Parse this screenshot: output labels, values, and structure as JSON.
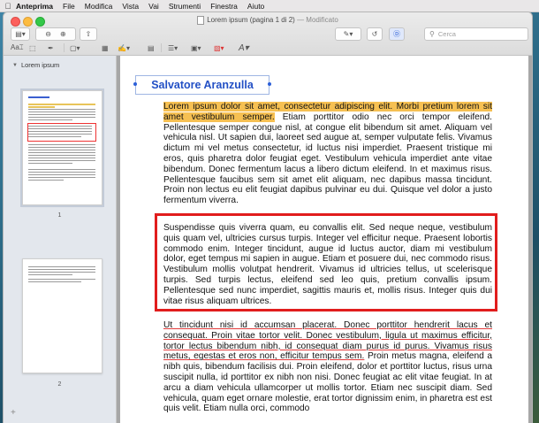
{
  "menubar": {
    "app_name": "Anteprima",
    "items": [
      "File",
      "Modifica",
      "Vista",
      "Vai",
      "Strumenti",
      "Finestra",
      "Aiuto"
    ]
  },
  "window": {
    "title": "Lorem ipsum (pagina 1 di 2)",
    "title_suffix": "— Modificato",
    "search_placeholder": "Cerca"
  },
  "sidebar": {
    "header": "Lorem ipsum",
    "pages": [
      "1",
      "2"
    ]
  },
  "document": {
    "annotation_text": "Salvatore Aranzulla",
    "paragraph1_highlight": "Lorem ipsum dolor sit amet, consectetur adipiscing elit. Morbi pretium lorem sit amet vestibulum semper.",
    "paragraph1_rest": " Etiam porttitor odio nec orci tempor eleifend. Pellentesque semper congue nisl, at congue elit bibendum sit amet. Aliquam vel vehicula nisl. Ut sapien dui, laoreet sed augue at, semper vulputate felis. Vivamus dictum mi vel metus consectetur, id luctus nisi imperdiet. Praesent tristique mi eros, quis pharetra dolor feugiat eget. Vestibulum vehicula imperdiet ante vitae bibendum. Donec fermentum lacus a libero dictum eleifend. In et maximus risus. Pellentesque faucibus sem sit amet elit aliquam, nec dapibus massa tincidunt. Proin non lectus eu elit feugiat dapibus pulvinar eu dui. Quisque vel dolor a justo fermentum viverra.",
    "paragraph2": "Suspendisse quis viverra quam, eu convallis elit. Sed neque neque, vestibulum quis quam vel, ultricies cursus turpis. Integer vel efficitur neque. Praesent lobortis commodo enim. Integer tincidunt, augue id luctus auctor, diam mi vestibulum dolor, eget tempus mi sapien in augue. Etiam et posuere dui, nec commodo risus. Vestibulum mollis volutpat hendrerit. Vivamus id ultricies tellus, ut scelerisque turpis. Sed turpis lectus, eleifend sed leo quis, pretium convallis ipsum. Pellentesque sed nunc imperdiet, sagittis mauris et, mollis risus. Integer quis dui vitae risus aliquam ultrices.",
    "paragraph3_underlined": "Ut tincidunt nisi id accumsan placerat. Donec porttitor hendrerit lacus et consequat. Proin vitae tortor velit. Donec vestibulum, ligula ut maximus efficitur, tortor lectus bibendum nibh, id consequat diam purus id purus. Vivamus risus metus, egestas et eros non, efficitur tempus sem.",
    "paragraph3_rest": " Proin metus magna, eleifend a nibh quis, bibendum facilisis dui. Proin eleifend, dolor et porttitor luctus, risus urna suscipit nulla, id porttitor ex nibh non nisi. Donec feugiat ac elit vitae feugiat. In at arcu a diam vehicula ullamcorper ut mollis tortor. Etiam nec suscipit diam. Sed vehicula, quam eget ornare molestie, erat tortor dignissim enim, in pharetra est est quis velit. Etiam nulla orci, commodo"
  },
  "colors": {
    "highlight": "#f6c052",
    "red_box": "#e11d1d",
    "annotation_text": "#2350c5"
  }
}
